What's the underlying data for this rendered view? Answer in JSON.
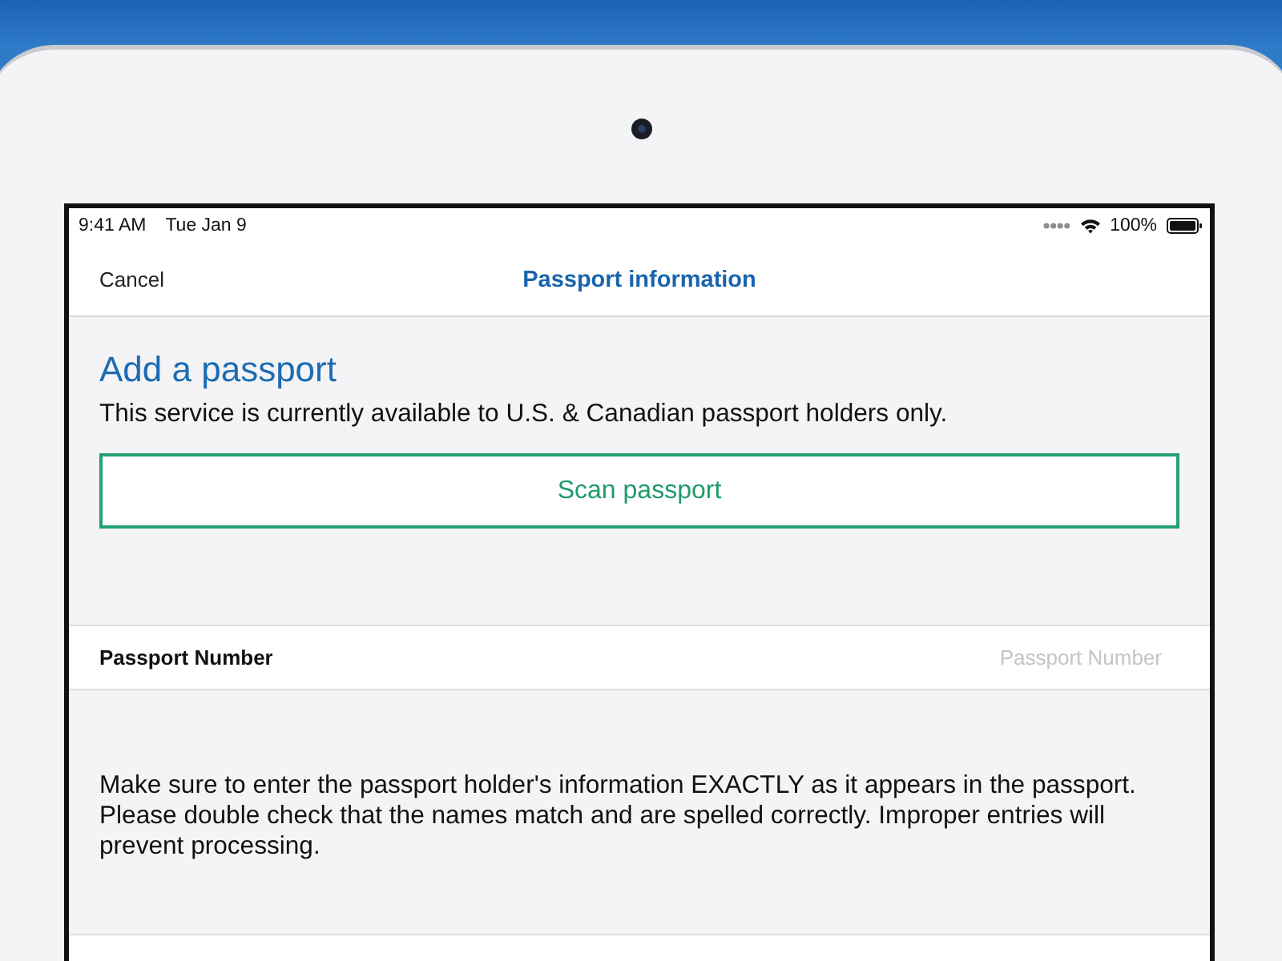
{
  "status_bar": {
    "time": "9:41 AM",
    "date": "Tue Jan 9",
    "battery": "100%"
  },
  "nav_bar": {
    "cancel": "Cancel",
    "title": "Passport information"
  },
  "header": {
    "title": "Add a passport",
    "subtitle": "This service is currently available to U.S. & Canadian passport holders only."
  },
  "scan_button": {
    "label": "Scan passport"
  },
  "form": {
    "fields": [
      {
        "label": "Passport Number",
        "placeholder": "Passport Number"
      }
    ]
  },
  "note": "Make sure to enter the passport holder's information EXACTLY as it appears in the passport. Please double check that the names match and are spelled correctly. Improper entries will prevent processing."
}
